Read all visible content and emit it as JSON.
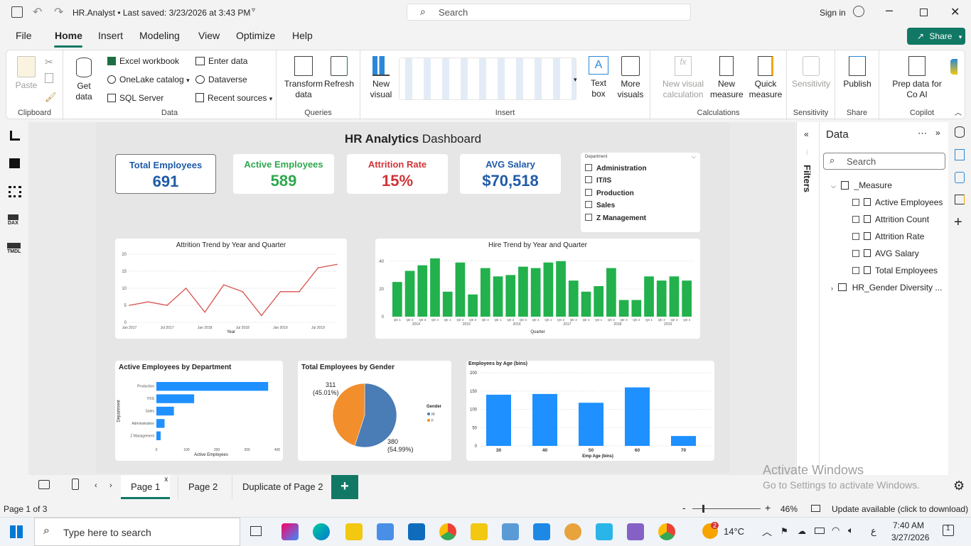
{
  "titlebar": {
    "app_title": "HR.Analyst • Last saved: 3/23/2026 at 3:43 PM",
    "search_placeholder": "Search",
    "sign_in": "Sign in"
  },
  "menu": {
    "items": [
      "File",
      "Home",
      "Insert",
      "Modeling",
      "View",
      "Optimize",
      "Help"
    ],
    "active": "Home",
    "share": "Share"
  },
  "ribbon": {
    "clipboard": {
      "paste": "Paste",
      "label": "Clipboard"
    },
    "data": {
      "get_data": "Get data",
      "excel": "Excel workbook",
      "onelake": "OneLake catalog",
      "sql": "SQL Server",
      "enter": "Enter data",
      "dataverse": "Dataverse",
      "recent": "Recent sources",
      "label": "Data"
    },
    "queries": {
      "transform": "Transform data",
      "refresh": "Refresh",
      "label": "Queries"
    },
    "insert": {
      "new_visual": "New visual",
      "text_box": "Text box",
      "more_visuals": "More visuals",
      "label": "Insert"
    },
    "calculations": {
      "new_visual_calc": "New visual calculation",
      "new_measure": "New measure",
      "quick_measure": "Quick measure",
      "label": "Calculations"
    },
    "sensitivity": {
      "btn": "Sensitivity",
      "label": "Sensitivity"
    },
    "share": {
      "publish": "Publish",
      "label": "Share"
    },
    "copilot": {
      "prep": "Prep data for Co AI",
      "label": "Copilot"
    }
  },
  "dashboard": {
    "title_bold": "HR Analytics",
    "title_rest": "Dashboard",
    "cards": [
      {
        "title": "Total Employees",
        "value": "691",
        "color": "#1f5ba8"
      },
      {
        "title": "Active Employees",
        "value": "589",
        "color": "#2ea84f"
      },
      {
        "title": "Attrition Rate",
        "value": "15%",
        "color": "#d13438"
      },
      {
        "title": "AVG Salary",
        "value": "$70,518",
        "color": "#1f5ba8"
      }
    ],
    "slicer": {
      "title": "Department",
      "items": [
        "Administration",
        "IT/IS",
        "Production",
        "Sales",
        "Z Management"
      ]
    }
  },
  "charts": {
    "attrition": {
      "title": "Attrition Trend by Year and Quarter",
      "xlabel": "Year"
    },
    "hire": {
      "title": "Hire Trend by Year and Quarter",
      "xlabel": "Quarter"
    },
    "dept": {
      "title": "Active Employees by Department",
      "xlabel": "Active Employees",
      "ylabel": "Department"
    },
    "gender": {
      "title": "Total Employees by Gender",
      "legend_title": "Gender",
      "label_m": "311",
      "label_m_pct": "(45.01%)",
      "label_f": "380",
      "label_f_pct": "(54.99%)"
    },
    "age": {
      "title": "Employees by Age (bins)",
      "xlabel": "Emp Age (bins)"
    }
  },
  "chart_data": [
    {
      "type": "line",
      "title": "Attrition Trend by Year and Quarter",
      "xlabel": "Year",
      "ylabel": "",
      "ylim": [
        0,
        20
      ],
      "yticks": [
        0,
        5,
        10,
        15,
        20
      ],
      "x_ticks": [
        "Jan 2017",
        "Jul 2017",
        "Jan 2018",
        "Jul 2018",
        "Jan 2019",
        "Jul 2019"
      ],
      "values": [
        5,
        6,
        5,
        10,
        3,
        11,
        9,
        2,
        9,
        9,
        16,
        17
      ],
      "color": "#d9534f"
    },
    {
      "type": "bar",
      "title": "Hire Trend by Year and Quarter",
      "xlabel": "Quarter",
      "ylim": [
        0,
        45
      ],
      "yticks": [
        0,
        20,
        40
      ],
      "categories": [
        "Qtr 1",
        "Qtr 2",
        "Qtr 3",
        "Qtr 4",
        "Qtr 1",
        "Qtr 2",
        "Qtr 3",
        "Qtr 4",
        "Qtr 1",
        "Qtr 2",
        "Qtr 3",
        "Qtr 4",
        "Qtr 1",
        "Qtr 2",
        "Qtr 3",
        "Qtr 4",
        "Qtr 1",
        "Qtr 2",
        "Qtr 3",
        "Qtr 4",
        "Qtr 1",
        "Qtr 2",
        "Qtr 3",
        "Qtr 4"
      ],
      "years": [
        "2014",
        "2015",
        "2016",
        "2017",
        "2018",
        "2019"
      ],
      "values": [
        25,
        33,
        37,
        42,
        18,
        39,
        16,
        35,
        29,
        30,
        36,
        35,
        39,
        40,
        26,
        18,
        22,
        35,
        12,
        12,
        29,
        26,
        29,
        26
      ],
      "color": "#22b14c"
    },
    {
      "type": "bar",
      "orientation": "horizontal",
      "title": "Active Employees by Department",
      "xlabel": "Active Employees",
      "ylabel": "Department",
      "categories": [
        "Production",
        "IT/IS",
        "Sales",
        "Administration",
        "Z Management"
      ],
      "values": [
        370,
        125,
        58,
        27,
        14
      ],
      "xlim": [
        0,
        400
      ],
      "xticks": [
        0,
        100,
        200,
        300,
        400
      ],
      "color": "#1e90ff"
    },
    {
      "type": "pie",
      "title": "Total Employees by Gender",
      "legend": [
        "M",
        "F"
      ],
      "values": [
        380,
        311
      ],
      "percents": [
        54.99,
        45.01
      ],
      "colors": [
        "#4a7cb5",
        "#f28e2b"
      ]
    },
    {
      "type": "bar",
      "title": "Employees by Age (bins)",
      "xlabel": "Emp Age (bins)",
      "categories": [
        "30",
        "40",
        "50",
        "60",
        "70"
      ],
      "values": [
        140,
        142,
        118,
        160,
        27
      ],
      "ylim": [
        0,
        200
      ],
      "yticks": [
        0,
        50,
        100,
        150,
        200
      ],
      "color": "#1e90ff"
    }
  ],
  "filters_label": "Filters",
  "datapane": {
    "title": "Data",
    "search_placeholder": "Search",
    "measure_table": "_Measure",
    "measures": [
      "Active Employees",
      "Attrition Count",
      "Attrition Rate",
      "AVG Salary",
      "Total Employees"
    ],
    "table2": "HR_Gender Diversity ..."
  },
  "pagetabs": [
    "Page 1",
    "Page 2",
    "Duplicate of Page 2"
  ],
  "status": {
    "page": "Page 1 of 3",
    "zoom": "46%",
    "update": "Update available (click to download)"
  },
  "activate": {
    "line1": "Activate Windows",
    "line2": "Go to Settings to activate Windows."
  },
  "taskbar": {
    "search": "Type here to search",
    "temp": "14°C",
    "time": "7:40 AM",
    "date": "3/27/2026",
    "lang": "ع",
    "notif": "1",
    "weather_badge": "2"
  }
}
